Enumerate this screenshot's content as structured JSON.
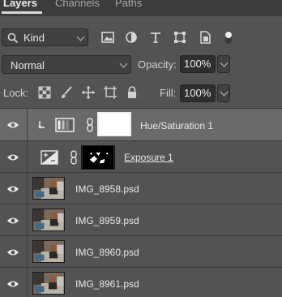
{
  "tabs": [
    {
      "label": "Layers",
      "active": true
    },
    {
      "label": "Channels",
      "active": false
    },
    {
      "label": "Paths",
      "active": false
    }
  ],
  "filter": {
    "kind_label": "Kind",
    "icons": [
      "search-icon",
      "pixel-filter-icon",
      "adjustment-filter-icon",
      "type-filter-icon",
      "shape-filter-icon",
      "smart-object-filter-icon",
      "filter-toggle-icon"
    ]
  },
  "blend": {
    "mode": "Normal",
    "opacity_label": "Opacity:",
    "opacity_value": "100%"
  },
  "lock": {
    "label": "Lock:",
    "icons": [
      "lock-transparent-pixels-icon",
      "lock-image-pixels-icon",
      "lock-position-icon",
      "lock-artboard-icon",
      "lock-all-icon"
    ],
    "fill_label": "Fill:",
    "fill_value": "100%"
  },
  "layers": [
    {
      "name": "Hue/Saturation 1",
      "type": "adjustment",
      "clipped": true,
      "selected": true,
      "visible": true
    },
    {
      "name": "Exposure 1",
      "type": "adjustment",
      "clipped": false,
      "selected": false,
      "visible": true
    },
    {
      "name": "IMG_8958.psd",
      "type": "smart-object",
      "selected": false,
      "visible": true
    },
    {
      "name": "IMG_8959.psd",
      "type": "smart-object",
      "selected": false,
      "visible": true
    },
    {
      "name": "IMG_8960.psd",
      "type": "smart-object",
      "selected": false,
      "visible": true
    },
    {
      "name": "IMG_8961.psd",
      "type": "smart-object",
      "selected": false,
      "visible": true
    }
  ],
  "colors": {
    "panel_bg": "#535353",
    "selected_row": "#6a6a6a",
    "field_bg": "#2e2e2e"
  }
}
